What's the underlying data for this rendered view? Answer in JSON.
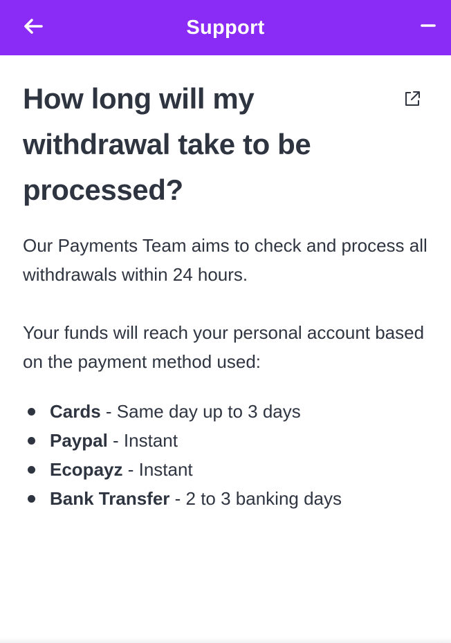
{
  "header": {
    "title": "Support",
    "back_icon": "arrow-left-icon",
    "minimize_icon": "minimize-icon",
    "background_color": "#8a2cf6"
  },
  "article": {
    "title": "How long will my withdrawal take to be processed?",
    "external_link_icon": "external-link-icon",
    "paragraphs": [
      "Our Payments Team aims to check and process all withdrawals within 24 hours.",
      "Your funds will reach your personal account based on the payment method used:"
    ],
    "methods": [
      {
        "name": "Cards",
        "detail": " - Same day up to 3 days"
      },
      {
        "name": "Paypal",
        "detail": " - Instant"
      },
      {
        "name": "Ecopayz",
        "detail": " - Instant"
      },
      {
        "name": "Bank Transfer",
        "detail": " - 2 to 3 banking days"
      }
    ]
  }
}
